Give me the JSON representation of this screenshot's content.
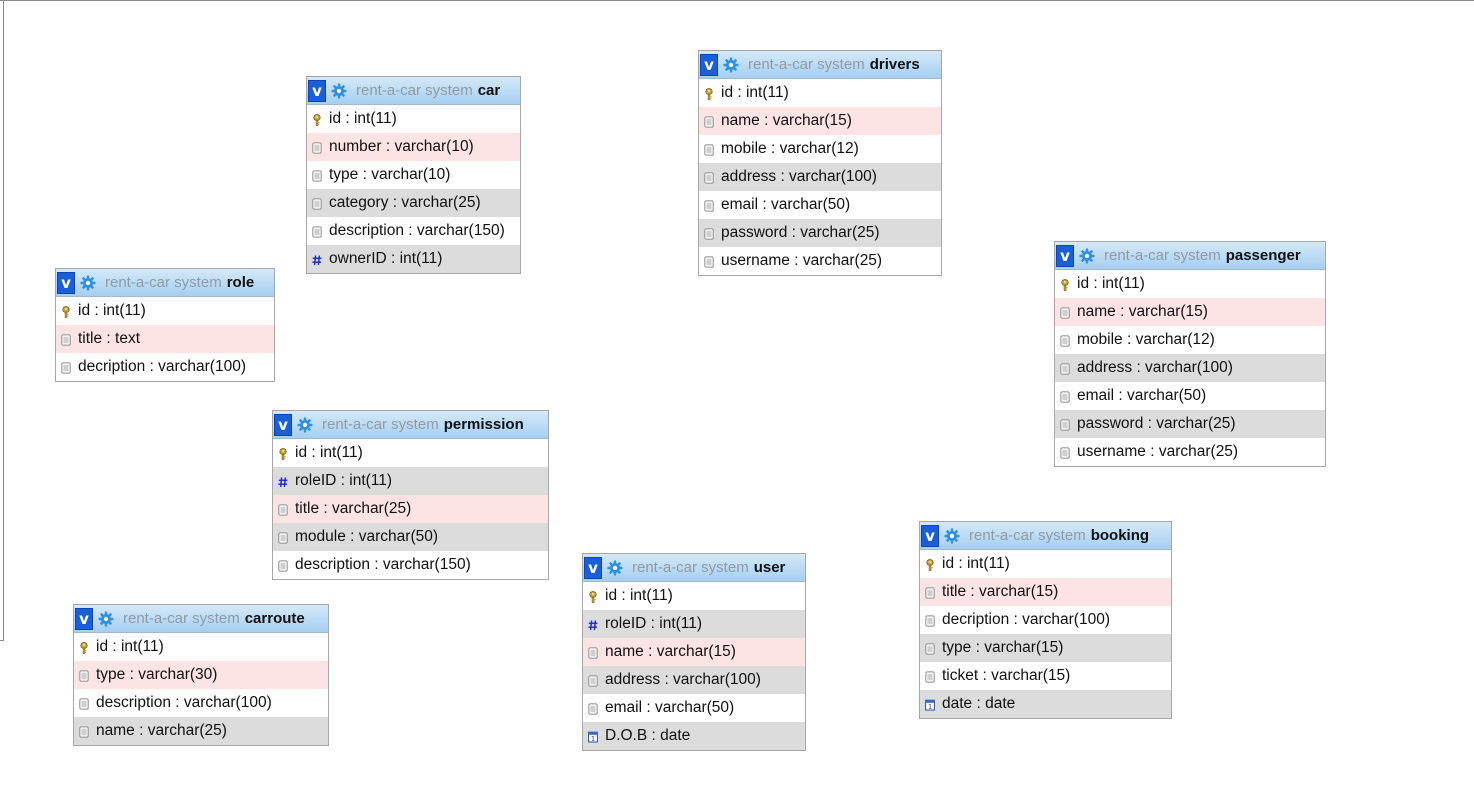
{
  "db_name": "rent-a-car system",
  "colors": {
    "header_top": "#d4e9f9",
    "header_bottom": "#a6cff0",
    "row_pink": "#fce4e4",
    "row_gray": "#dcdcdc",
    "v_badge": "#1a5fd8"
  },
  "tables": {
    "car": {
      "name": "car",
      "columns": [
        {
          "text": "id : int(11)",
          "icon": "primary-key-icon"
        },
        {
          "text": "number : varchar(10)",
          "icon": "column-icon"
        },
        {
          "text": "type : varchar(10)",
          "icon": "column-icon"
        },
        {
          "text": "category : varchar(25)",
          "icon": "column-icon"
        },
        {
          "text": "description : varchar(150)",
          "icon": "column-icon"
        },
        {
          "text": "ownerID : int(11)",
          "icon": "foreign-key-icon"
        }
      ]
    },
    "drivers": {
      "name": "drivers",
      "columns": [
        {
          "text": "id : int(11)",
          "icon": "primary-key-icon"
        },
        {
          "text": "name : varchar(15)",
          "icon": "column-icon"
        },
        {
          "text": "mobile : varchar(12)",
          "icon": "column-icon"
        },
        {
          "text": "address : varchar(100)",
          "icon": "column-icon"
        },
        {
          "text": "email : varchar(50)",
          "icon": "column-icon"
        },
        {
          "text": "password : varchar(25)",
          "icon": "column-icon"
        },
        {
          "text": "username : varchar(25)",
          "icon": "column-icon"
        }
      ]
    },
    "role": {
      "name": "role",
      "columns": [
        {
          "text": "id : int(11)",
          "icon": "primary-key-icon"
        },
        {
          "text": "title : text",
          "icon": "column-icon"
        },
        {
          "text": "decription : varchar(100)",
          "icon": "column-icon"
        }
      ]
    },
    "passenger": {
      "name": "passenger",
      "columns": [
        {
          "text": "id : int(11)",
          "icon": "primary-key-icon"
        },
        {
          "text": "name : varchar(15)",
          "icon": "column-icon"
        },
        {
          "text": "mobile : varchar(12)",
          "icon": "column-icon"
        },
        {
          "text": "address : varchar(100)",
          "icon": "column-icon"
        },
        {
          "text": "email : varchar(50)",
          "icon": "column-icon"
        },
        {
          "text": "password : varchar(25)",
          "icon": "column-icon"
        },
        {
          "text": "username : varchar(25)",
          "icon": "column-icon"
        }
      ]
    },
    "permission": {
      "name": "permission",
      "columns": [
        {
          "text": "id : int(11)",
          "icon": "primary-key-icon"
        },
        {
          "text": "roleID : int(11)",
          "icon": "foreign-key-icon"
        },
        {
          "text": "title : varchar(25)",
          "icon": "column-icon"
        },
        {
          "text": "module : varchar(50)",
          "icon": "column-icon"
        },
        {
          "text": "description : varchar(150)",
          "icon": "column-icon"
        }
      ]
    },
    "user": {
      "name": "user",
      "columns": [
        {
          "text": "id : int(11)",
          "icon": "primary-key-icon"
        },
        {
          "text": "roleID : int(11)",
          "icon": "foreign-key-icon"
        },
        {
          "text": "name : varchar(15)",
          "icon": "column-icon"
        },
        {
          "text": "address : varchar(100)",
          "icon": "column-icon"
        },
        {
          "text": "email : varchar(50)",
          "icon": "column-icon"
        },
        {
          "text": "D.O.B : date",
          "icon": "date-icon"
        }
      ]
    },
    "booking": {
      "name": "booking",
      "columns": [
        {
          "text": "id : int(11)",
          "icon": "primary-key-icon"
        },
        {
          "text": "title : varchar(15)",
          "icon": "column-icon"
        },
        {
          "text": "decription : varchar(100)",
          "icon": "column-icon"
        },
        {
          "text": "type : varchar(15)",
          "icon": "column-icon"
        },
        {
          "text": "ticket : varchar(15)",
          "icon": "column-icon"
        },
        {
          "text": "date : date",
          "icon": "date-icon"
        }
      ]
    },
    "carroute": {
      "name": "carroute",
      "columns": [
        {
          "text": "id : int(11)",
          "icon": "primary-key-icon"
        },
        {
          "text": "type : varchar(30)",
          "icon": "column-icon"
        },
        {
          "text": "description : varchar(100)",
          "icon": "column-icon"
        },
        {
          "text": "name : varchar(25)",
          "icon": "column-icon"
        }
      ]
    }
  }
}
